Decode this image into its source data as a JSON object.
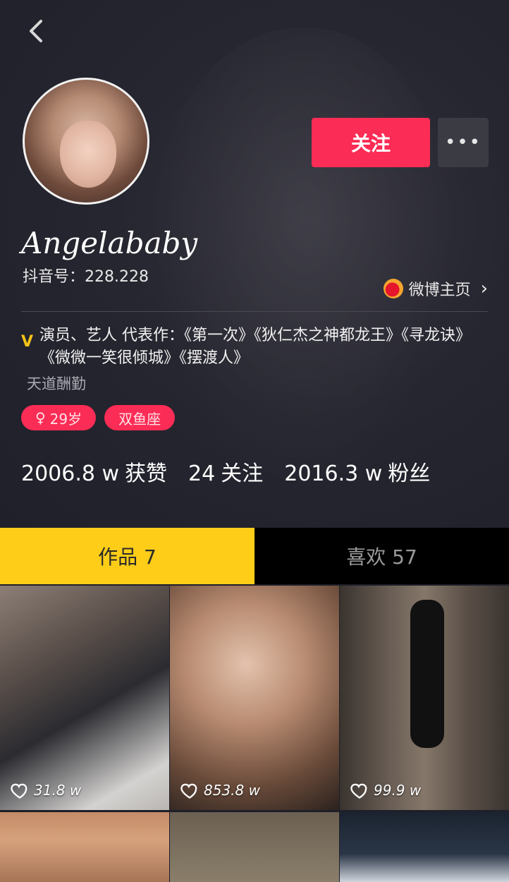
{
  "header": {
    "back_icon": "chevron-left-icon",
    "follow_label": "关注",
    "more_label": "•••",
    "nickname": "Angelababy",
    "douyin_id": "抖音号：228.228",
    "weibo_label": "微博主页",
    "weibo_chevron": "›",
    "verified_badge": "V",
    "bio": "演员、艺人 代表作：《第一次》《狄仁杰之神都龙王》《寻龙诀》《微微一笑很倾城》《摆渡人》",
    "signature": "天道酬勤",
    "tags": [
      {
        "symbol": "♀",
        "label": "29岁"
      },
      {
        "symbol": "",
        "label": "双鱼座"
      }
    ],
    "stats": [
      {
        "value": "2006.8 w",
        "label": "获赞"
      },
      {
        "value": "24",
        "label": "关注"
      },
      {
        "value": "2016.3 w",
        "label": "粉丝"
      }
    ]
  },
  "tabs": [
    {
      "label": "作品 7",
      "active": true
    },
    {
      "label": "喜欢 57",
      "active": false
    }
  ],
  "grid": [
    {
      "likes": "31.8 w"
    },
    {
      "likes": "853.8 w"
    },
    {
      "likes": "99.9 w"
    }
  ],
  "colors": {
    "accent": "#fb2c55",
    "tab_active": "#fdcd18",
    "background": "#1e1f29"
  }
}
